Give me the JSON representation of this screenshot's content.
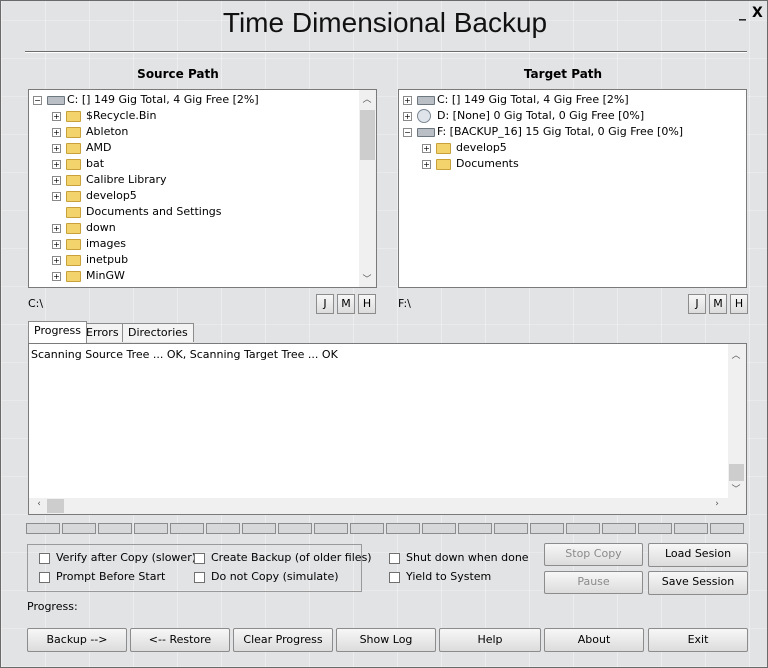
{
  "window": {
    "title": "Time Dimensional Backup",
    "minimize": "_",
    "close": "X"
  },
  "source": {
    "label": "Source Path",
    "path": "C:\\",
    "items": [
      {
        "text": "C: [] 149 Gig Total, 4 Gig Free [2%]",
        "type": "drive",
        "level": 0,
        "expander": "−"
      },
      {
        "text": "$Recycle.Bin",
        "type": "folder",
        "level": 1,
        "expander": "+"
      },
      {
        "text": "Ableton",
        "type": "folder",
        "level": 1,
        "expander": "+"
      },
      {
        "text": "AMD",
        "type": "folder",
        "level": 1,
        "expander": "+"
      },
      {
        "text": "bat",
        "type": "folder",
        "level": 1,
        "expander": "+"
      },
      {
        "text": "Calibre Library",
        "type": "folder",
        "level": 1,
        "expander": "+"
      },
      {
        "text": "develop5",
        "type": "folder",
        "level": 1,
        "expander": "+"
      },
      {
        "text": "Documents and Settings",
        "type": "folder",
        "level": 1,
        "expander": ""
      },
      {
        "text": "down",
        "type": "folder",
        "level": 1,
        "expander": "+"
      },
      {
        "text": "images",
        "type": "folder",
        "level": 1,
        "expander": "+"
      },
      {
        "text": "inetpub",
        "type": "folder",
        "level": 1,
        "expander": "+"
      },
      {
        "text": "MinGW",
        "type": "folder",
        "level": 1,
        "expander": "+"
      }
    ],
    "jump_buttons": [
      "J",
      "M",
      "H"
    ]
  },
  "target": {
    "label": "Target Path",
    "path": "F:\\",
    "items": [
      {
        "text": "C: [] 149 Gig Total, 4 Gig Free [2%]",
        "type": "drive",
        "level": 0,
        "expander": "+"
      },
      {
        "text": "D: [None] 0 Gig Total, 0 Gig Free [0%]",
        "type": "cd",
        "level": 0,
        "expander": "+"
      },
      {
        "text": "F: [BACKUP_16] 15 Gig Total, 0 Gig Free [0%]",
        "type": "drive",
        "level": 0,
        "expander": "−"
      },
      {
        "text": "develop5",
        "type": "folder",
        "level": 1,
        "expander": "+"
      },
      {
        "text": "Documents",
        "type": "folder",
        "level": 1,
        "expander": "+"
      }
    ],
    "jump_buttons": [
      "J",
      "M",
      "H"
    ]
  },
  "tabs": [
    {
      "label": "Progress",
      "active": true
    },
    {
      "label": "Errors",
      "active": false
    },
    {
      "label": "Directories",
      "active": false
    }
  ],
  "log": {
    "text": "Scanning Source Tree ... OK, Scanning  Target Tree ... OK"
  },
  "options": {
    "verify": "Verify after Copy (slower)",
    "create_backup": "Create Backup (of older files)",
    "prompt": "Prompt Before Start",
    "no_copy": "Do not Copy (simulate)",
    "shutdown": "Shut down when done",
    "yield": "Yield to System"
  },
  "actions": {
    "stop_copy": "Stop Copy",
    "pause": "Pause",
    "load_session": "Load Sesion",
    "save_session": "Save Session"
  },
  "progress_label": "Progress:",
  "segment_count": 20,
  "bottom": {
    "backup": "Backup -->",
    "restore": "<-- Restore",
    "clear": "Clear Progress",
    "show_log": "Show Log",
    "help": "Help",
    "about": "About",
    "exit": "Exit"
  }
}
